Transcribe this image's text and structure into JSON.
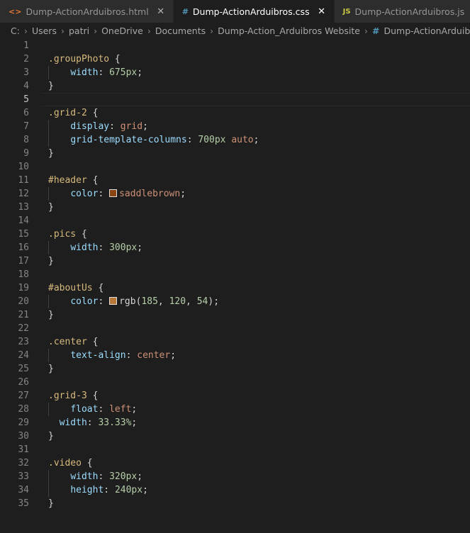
{
  "tabs": [
    {
      "label": "Dump-ActionArduibros.html",
      "icon": "html-file-icon",
      "active": false
    },
    {
      "label": "Dump-ActionArduibros.css",
      "icon": "css-file-icon",
      "active": true
    },
    {
      "label": "Dump-ActionArduibros.js",
      "icon": "js-file-icon",
      "active": false
    }
  ],
  "breadcrumb": [
    "C:",
    "Users",
    "patri",
    "OneDrive",
    "Documents",
    "Dump-Action_Arduibros Website",
    "Dump-ActionArduibros.css"
  ],
  "colors": {
    "saddlebrown": "#8b4513",
    "rgb_swatch": "#b97836"
  },
  "code_lines": [
    {
      "n": "1",
      "sel": "",
      "prop": "",
      "value": "",
      "unit": "",
      "punc": ""
    },
    {
      "n": "2",
      "sel": ".groupPhoto",
      "open": " {"
    },
    {
      "n": "3",
      "prop": "width",
      "num": "675px"
    },
    {
      "n": "4",
      "close": "}"
    },
    {
      "n": "5"
    },
    {
      "n": "6",
      "sel": ".grid-2",
      "open": " {"
    },
    {
      "n": "7",
      "prop": "display",
      "val": "grid"
    },
    {
      "n": "8",
      "prop": "grid-template-columns",
      "num": "700px",
      "val2": "auto"
    },
    {
      "n": "9",
      "close": "}"
    },
    {
      "n": "10"
    },
    {
      "n": "11",
      "sel": "#header",
      "open": " {"
    },
    {
      "n": "12",
      "prop": "color",
      "swatch": "saddlebrown",
      "val": "saddlebrown"
    },
    {
      "n": "13",
      "close": "}"
    },
    {
      "n": "14"
    },
    {
      "n": "15",
      "sel": ".pics",
      "open": " {"
    },
    {
      "n": "16",
      "prop": "width",
      "num": "300px"
    },
    {
      "n": "17",
      "close": "}"
    },
    {
      "n": "18"
    },
    {
      "n": "19",
      "sel": "#aboutUs",
      "open": " {"
    },
    {
      "n": "20",
      "prop": "color",
      "swatch": "rgb_swatch",
      "rgb": [
        "185",
        "120",
        "54"
      ]
    },
    {
      "n": "21",
      "close": "}"
    },
    {
      "n": "22"
    },
    {
      "n": "23",
      "sel": ".center",
      "open": " {"
    },
    {
      "n": "24",
      "prop": "text-align",
      "val": "center"
    },
    {
      "n": "25",
      "close": "}"
    },
    {
      "n": "26"
    },
    {
      "n": "27",
      "sel": ".grid-3",
      "open": " {"
    },
    {
      "n": "28",
      "prop": "float",
      "val": "left"
    },
    {
      "n": "29",
      "prop": "width",
      "num": "33.33%",
      "indent": "  "
    },
    {
      "n": "30",
      "close": "}"
    },
    {
      "n": "31"
    },
    {
      "n": "32",
      "sel": ".video",
      "open": " {"
    },
    {
      "n": "33",
      "prop": "width",
      "num": "320px"
    },
    {
      "n": "34",
      "prop": "height",
      "num": "240px"
    },
    {
      "n": "35",
      "close": "}"
    }
  ],
  "current_line": "5"
}
